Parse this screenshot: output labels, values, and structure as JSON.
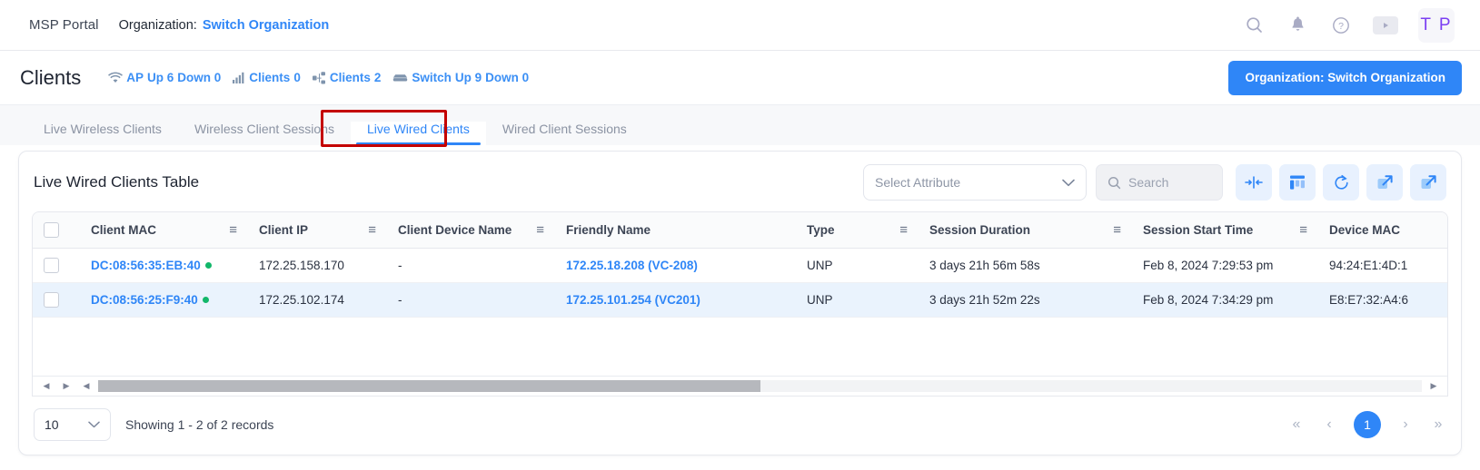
{
  "topbar": {
    "brand": "MSP Portal",
    "org_label": "Organization:",
    "org_link": "Switch Organization",
    "icons": {
      "search": "search-icon",
      "bell": "bell-icon",
      "help": "help-circle-icon",
      "play": "play-icon"
    },
    "avatar_initials": "T P"
  },
  "pagehead": {
    "title": "Clients",
    "stats": [
      {
        "icon": "wifi-icon",
        "label": "AP",
        "fields": "Up 6  Down 0",
        "parts": [
          "Up 6",
          "Down 0"
        ]
      },
      {
        "icon": "signal-bars-icon",
        "label": "Clients",
        "value": "0"
      },
      {
        "icon": "network-icon",
        "label": "Clients",
        "value": "2"
      },
      {
        "icon": "switch-icon",
        "label": "Switch",
        "fields": "Up 9  Down 0"
      }
    ],
    "stat_texts": {
      "ap": "AP",
      "ap_up": "Up 6",
      "ap_down": "Down 0",
      "wireless_clients": "Clients",
      "wireless_clients_value": "0",
      "wired_clients": "Clients",
      "wired_clients_value": "2",
      "switch": "Switch",
      "switch_up": "Up 9",
      "switch_down": "Down 0"
    },
    "org_button": "Organization: Switch Organization",
    "accent_color": "#2f86f7"
  },
  "tabs": [
    {
      "label": "Live Wireless Clients",
      "active": false
    },
    {
      "label": "Wireless Client Sessions",
      "active": false
    },
    {
      "label": "Live Wired Clients",
      "active": true,
      "highlighted": true
    },
    {
      "label": "Wired Client Sessions",
      "active": false
    }
  ],
  "tab_labels": {
    "t0": "Live Wireless Clients",
    "t1": "Wireless Client Sessions",
    "t2": "Live Wired Clients",
    "t3": "Wired Client Sessions"
  },
  "card": {
    "title": "Live Wired Clients Table",
    "attribute_select": {
      "value": "Select Attribute"
    },
    "search": {
      "placeholder": "Search",
      "value": ""
    },
    "tools": [
      "fit-columns-icon",
      "column-chooser-icon",
      "refresh-icon",
      "expand-icon",
      "export-icon"
    ]
  },
  "table": {
    "columns": [
      "Client MAC",
      "Client IP",
      "Client Device Name",
      "Friendly Name",
      "Type",
      "Session Duration",
      "Session Start Time",
      "Device MAC"
    ],
    "column_keys": {
      "c0": "Client MAC",
      "c1": "Client IP",
      "c2": "Client Device Name",
      "c3": "Friendly Name",
      "c4": "Type",
      "c5": "Session Duration",
      "c6": "Session Start Time",
      "c7": "Device MAC"
    },
    "menu_glyph": "≡",
    "rows": [
      {
        "client_mac": "DC:08:56:35:EB:40",
        "status": "online",
        "client_ip": "172.25.158.170",
        "client_device_name": "-",
        "friendly_name": "172.25.18.208 (VC-208)",
        "type": "UNP",
        "session_duration": "3 days 21h 56m 58s",
        "session_start_time": "Feb 8, 2024 7:29:53 pm",
        "device_mac": "94:24:E1:4D:1"
      },
      {
        "client_mac": "DC:08:56:25:F9:40",
        "status": "online",
        "client_ip": "172.25.102.174",
        "client_device_name": "-",
        "friendly_name": "172.25.101.254 (VC201)",
        "type": "UNP",
        "session_duration": "3 days 21h 52m 22s",
        "session_start_time": "Feb 8, 2024 7:34:29 pm",
        "device_mac": "E8:E7:32:A4:6"
      }
    ]
  },
  "footer": {
    "page_size": "10",
    "records_text": "Showing 1 - 2 of 2 records",
    "pager": {
      "first": "«",
      "prev": "‹",
      "current": "1",
      "next": "›",
      "last": "»"
    }
  }
}
